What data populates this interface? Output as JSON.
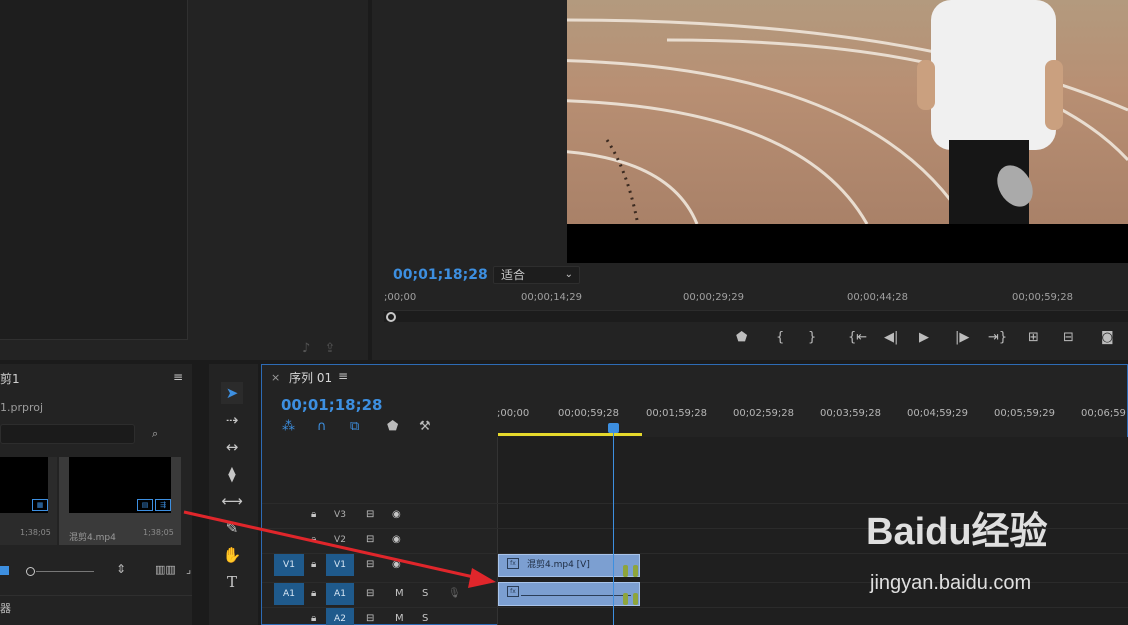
{
  "project": {
    "title": "剪1",
    "file": "1.prproj",
    "menu_icon": "≡",
    "clips": [
      {
        "name": "",
        "duration": "1;38;05",
        "badge": "audio-icon"
      },
      {
        "name": "混剪4.mp4",
        "duration": "1;38;05",
        "badge": "av-icon"
      }
    ],
    "bottom_label": "器"
  },
  "program_monitor": {
    "timecode": "00;01;18;28",
    "fit_option": "适合",
    "ruler_ticks": [
      ";00;00",
      "00;00;14;29",
      "00;00;29;29",
      "00;00;44;28",
      "00;00;59;28"
    ],
    "controls": [
      "marker-icon",
      "mark-in-icon",
      "mark-out-icon",
      "go-to-in-icon",
      "step-back-icon",
      "play-icon",
      "step-forward-icon",
      "go-to-out-icon",
      "lift-icon",
      "extract-icon",
      "export-frame-icon"
    ]
  },
  "timeline": {
    "close": "×",
    "sequence_name": "序列 01",
    "menu_icon": "≡",
    "timecode": "00;01;18;28",
    "ruler_ticks": [
      ";00;00",
      "00;00;59;28",
      "00;01;59;28",
      "00;02;59;28",
      "00;03;59;28",
      "00;04;59;29",
      "00;05;59;29",
      "00;06;59"
    ],
    "tracks": [
      {
        "src": "",
        "name": "V3",
        "type": "video"
      },
      {
        "src": "",
        "name": "V2",
        "type": "video"
      },
      {
        "src": "V1",
        "name": "V1",
        "type": "video"
      },
      {
        "src": "A1",
        "name": "A1",
        "type": "audio"
      },
      {
        "src": "",
        "name": "A2",
        "type": "audio"
      }
    ],
    "audio_buttons": {
      "mute": "M",
      "solo": "S"
    },
    "video_clip": {
      "label": "混剪4.mp4 [V]",
      "fx": "fx"
    },
    "audio_clip": {
      "fx": "fx"
    }
  },
  "watermark": {
    "main": "Baidu经验",
    "sub": "jingyan.baidu.com"
  },
  "colors": {
    "accent": "#3d8fe0",
    "clip": "#7c9fd1",
    "work_area": "#e6d92c",
    "annotation_arrow": "#e0262b"
  }
}
